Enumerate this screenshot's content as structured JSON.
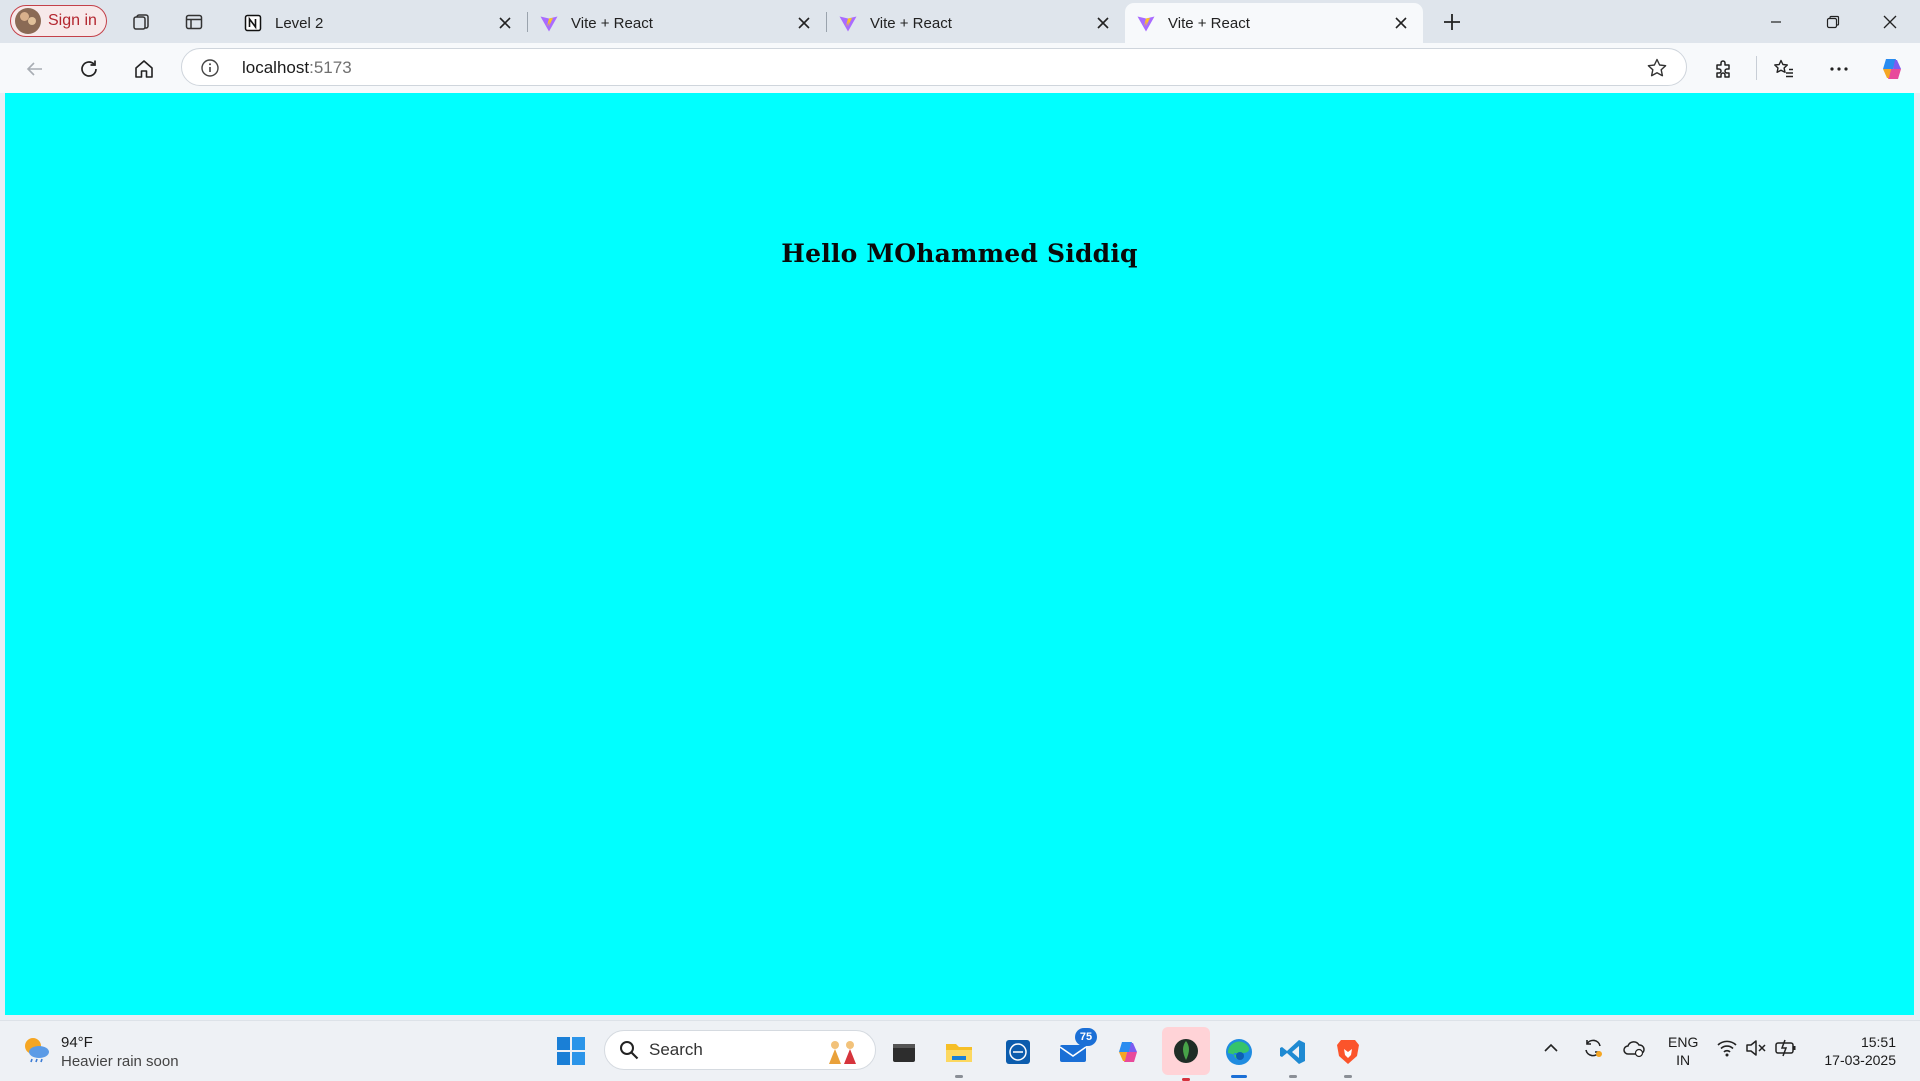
{
  "browser": {
    "signin_label": "Sign in",
    "tabs": [
      {
        "title": "Level 2",
        "favicon": "notion-icon",
        "active": false
      },
      {
        "title": "Vite + React",
        "favicon": "vite-icon",
        "active": false
      },
      {
        "title": "Vite + React",
        "favicon": "vite-icon",
        "active": false
      },
      {
        "title": "Vite + React",
        "favicon": "vite-icon",
        "active": true
      }
    ],
    "address": {
      "host": "localhost",
      "port": ":5173"
    }
  },
  "page": {
    "background": "#00ffff",
    "heading": "Hello MOhammed Siddiq"
  },
  "taskbar": {
    "weather": {
      "temp": "94°F",
      "condition": "Heavier rain soon"
    },
    "search_label": "Search",
    "mail_badge": "75",
    "language": {
      "line1": "ENG",
      "line2": "IN"
    },
    "clock": {
      "time": "15:51",
      "date": "17-03-2025"
    }
  }
}
